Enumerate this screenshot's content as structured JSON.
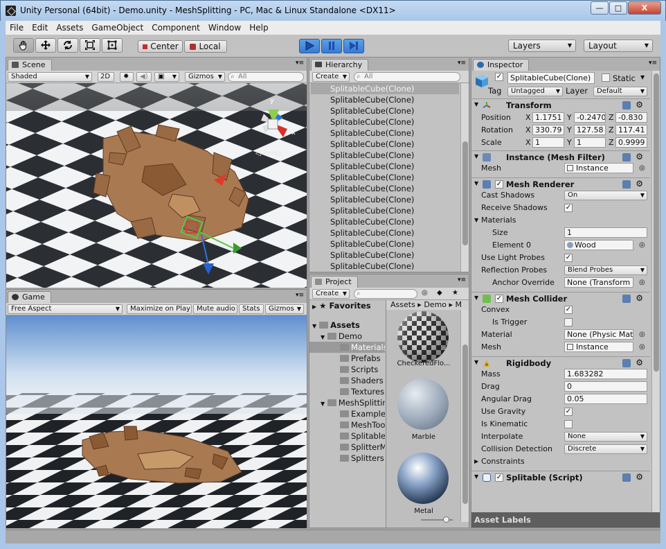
{
  "window": {
    "title": "Unity Personal (64bit) - Demo.unity - MeshSplitting - PC, Mac & Linux Standalone <DX11>",
    "minimize": "—",
    "maximize": "□",
    "close": "X"
  },
  "menu": [
    "File",
    "Edit",
    "Assets",
    "GameObject",
    "Component",
    "Window",
    "Help"
  ],
  "toolbar": {
    "pivot": "Center",
    "space": "Local",
    "layers": "Layers",
    "layout": "Layout"
  },
  "scene": {
    "tab": "Scene",
    "shading": "Shaded",
    "mode2d": "2D",
    "gizmos": "Gizmos",
    "search": "All",
    "persp": "◁ Persp",
    "gizmo_x": "x",
    "gizmo_y": "y"
  },
  "game": {
    "tab": "Game",
    "aspect": "Free Aspect",
    "maximize": "Maximize on Play",
    "mute": "Mute audio",
    "stats": "Stats",
    "gizmos": "Gizmos"
  },
  "hierarchy": {
    "tab": "Hierarchy",
    "create": "Create",
    "search": "All",
    "items": [
      "SplitableCube(Clone)",
      "SplitableCube(Clone)",
      "SplitableCube(Clone)",
      "SplitableCube(Clone)",
      "SplitableCube(Clone)",
      "SplitableCube(Clone)",
      "SplitableCube(Clone)",
      "SplitableCube(Clone)",
      "SplitableCube(Clone)",
      "SplitableCube(Clone)",
      "SplitableCube(Clone)",
      "SplitableCube(Clone)",
      "SplitableCube(Clone)",
      "SplitableCube(Clone)",
      "SplitableCube(Clone)",
      "SplitableCube(Clone)",
      "SplitableCube(Clone)"
    ]
  },
  "project": {
    "tab": "Project",
    "create": "Create",
    "favorites": "Favorites",
    "assets": "Assets",
    "tree": [
      {
        "label": "Demo",
        "level": 1
      },
      {
        "label": "Materials",
        "level": 2
      },
      {
        "label": "Prefabs",
        "level": 2
      },
      {
        "label": "Scripts",
        "level": 2
      },
      {
        "label": "Shaders",
        "level": 2
      },
      {
        "label": "Textures",
        "level": 2
      },
      {
        "label": "MeshSplitting",
        "level": 1
      },
      {
        "label": "Examples",
        "level": 2
      },
      {
        "label": "MeshTools",
        "level": 2
      },
      {
        "label": "Splitables",
        "level": 2
      },
      {
        "label": "SplitterMan",
        "level": 2
      },
      {
        "label": "Splitters",
        "level": 2
      }
    ],
    "breadcrumb": [
      "Assets",
      "Demo",
      "M"
    ],
    "files": [
      "CheckeredFlo...",
      "Marble",
      "Metal"
    ]
  },
  "inspector": {
    "tab": "Inspector",
    "name": "SplitableCube(Clone)",
    "static": "Static",
    "tag_label": "Tag",
    "tag": "Untagged",
    "layer_label": "Layer",
    "layer": "Default",
    "transform": {
      "title": "Transform",
      "position_label": "Position",
      "position": [
        "1.1751",
        "-0.2470",
        "-0.830"
      ],
      "rotation_label": "Rotation",
      "rotation": [
        "330.79",
        "127.58",
        "117.41"
      ],
      "scale_label": "Scale",
      "scale": [
        "1",
        "1",
        "0.9999"
      ],
      "axes": [
        "X",
        "Y",
        "Z"
      ]
    },
    "mesh_filter": {
      "title": "Instance (Mesh Filter)",
      "mesh_label": "Mesh",
      "mesh": "Instance"
    },
    "mesh_renderer": {
      "title": "Mesh Renderer",
      "cast_shadows_label": "Cast Shadows",
      "cast_shadows": "On",
      "receive_shadows_label": "Receive Shadows",
      "materials_label": "Materials",
      "size_label": "Size",
      "size": "1",
      "element0_label": "Element 0",
      "element0": "Wood",
      "light_probes_label": "Use Light Probes",
      "reflection_probes_label": "Reflection Probes",
      "reflection_probes": "Blend Probes",
      "anchor_label": "Anchor Override",
      "anchor": "None (Transform"
    },
    "mesh_collider": {
      "title": "Mesh Collider",
      "convex_label": "Convex",
      "trigger_label": "Is Trigger",
      "material_label": "Material",
      "material": "None (Physic Mat",
      "mesh_label": "Mesh",
      "mesh": "Instance"
    },
    "rigidbody": {
      "title": "Rigidbody",
      "mass_label": "Mass",
      "mass": "1.683282",
      "drag_label": "Drag",
      "drag": "0",
      "angular_label": "Angular Drag",
      "angular": "0.05",
      "gravity_label": "Use Gravity",
      "kinematic_label": "Is Kinematic",
      "interpolate_label": "Interpolate",
      "interpolate": "None",
      "collision_label": "Collision Detection",
      "collision": "Discrete",
      "constraints_label": "Constraints"
    },
    "splitable": {
      "title": "Splitable (Script)"
    },
    "asset_labels": "Asset Labels"
  },
  "colors": {
    "play_active": "#3a7ad0",
    "title_bar": "#b6cfee",
    "panel": "#c2c2c2"
  }
}
